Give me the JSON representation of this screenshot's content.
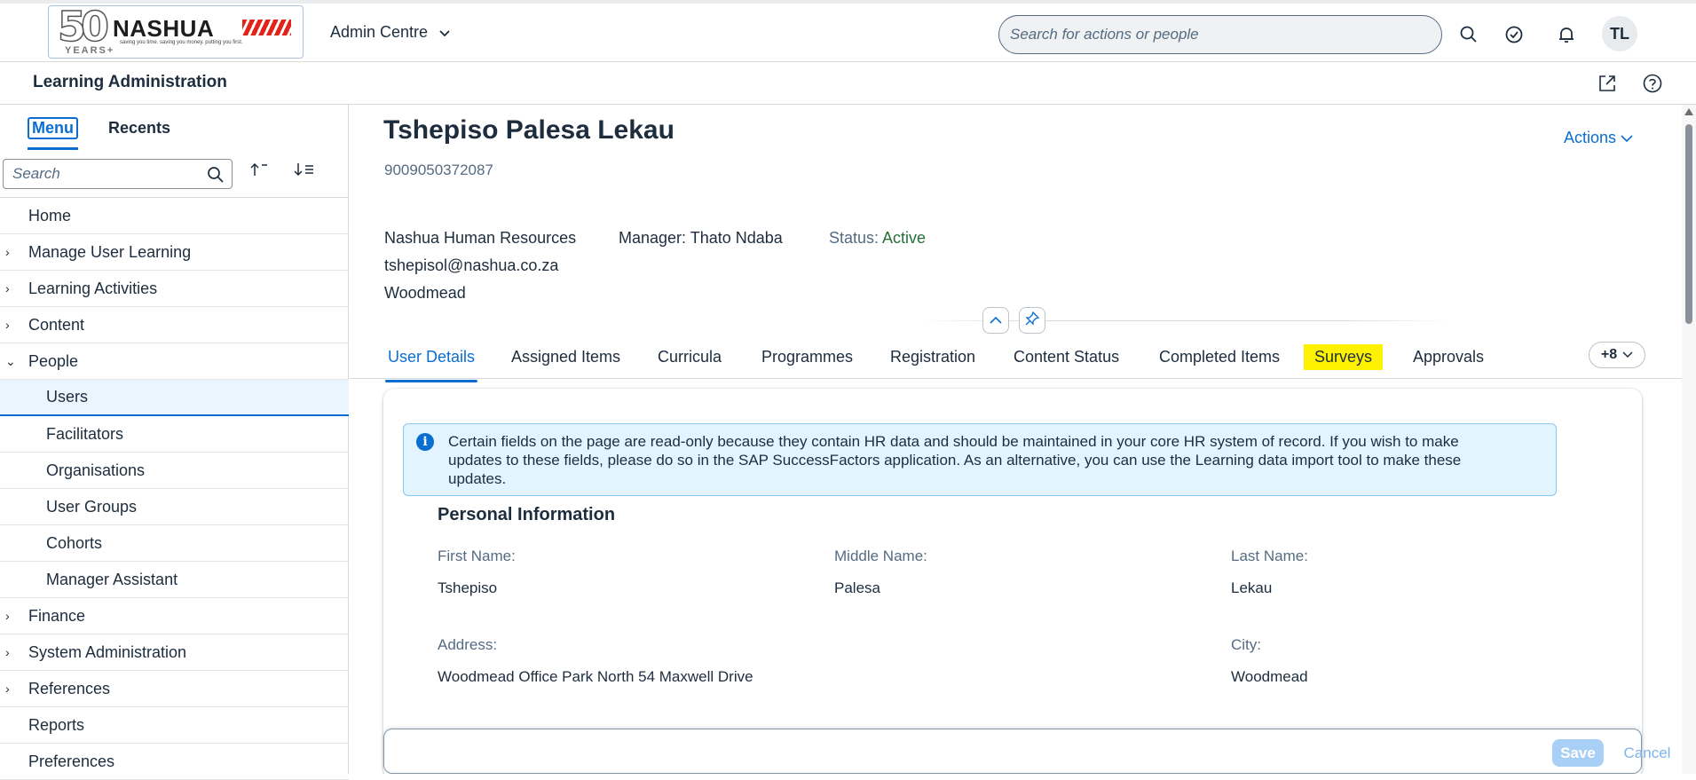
{
  "shell": {
    "logo": {
      "fifty": "50",
      "brand": "NASHUA",
      "tagline": "saving you time. saving you money. putting you first.",
      "years": "YEARS+"
    },
    "app_title": "Admin Centre",
    "search_placeholder": "Search for actions or people",
    "avatar_initials": "TL"
  },
  "subheader": {
    "title": "Learning Administration"
  },
  "nav": {
    "tabs": {
      "menu": "Menu",
      "recents": "Recents"
    },
    "search_placeholder": "Search",
    "items": [
      {
        "label": "Home",
        "expand": ""
      },
      {
        "label": "Manage User Learning",
        "expand": "›"
      },
      {
        "label": "Learning Activities",
        "expand": "›"
      },
      {
        "label": "Content",
        "expand": "›"
      },
      {
        "label": "People",
        "expand": "⌄"
      },
      {
        "label": "Users",
        "expand": ""
      },
      {
        "label": "Facilitators",
        "expand": ""
      },
      {
        "label": "Organisations",
        "expand": ""
      },
      {
        "label": "User Groups",
        "expand": ""
      },
      {
        "label": "Cohorts",
        "expand": ""
      },
      {
        "label": "Manager Assistant",
        "expand": ""
      },
      {
        "label": "Finance",
        "expand": "›"
      },
      {
        "label": "System Administration",
        "expand": "›"
      },
      {
        "label": "References",
        "expand": "›"
      },
      {
        "label": "Reports",
        "expand": ""
      },
      {
        "label": "Preferences",
        "expand": ""
      }
    ]
  },
  "header": {
    "name": "Tshepiso Palesa Lekau",
    "id": "9009050372087",
    "actions": "Actions",
    "department": "Nashua Human Resources",
    "manager": "Manager: Thato Ndaba",
    "status_label": "Status:",
    "status_value": "Active",
    "email": "tshepisol@nashua.co.za",
    "location": "Woodmead"
  },
  "tabs": [
    "User Details",
    "Assigned Items",
    "Curricula",
    "Programmes",
    "Registration",
    "Content Status",
    "Completed Items",
    "Surveys",
    "Approvals"
  ],
  "more_tabs": "+8",
  "message": "Certain fields on the page are read-only because they contain HR data and should be maintained in your core HR system of record. If you wish to make updates to these fields, please do so in the SAP SuccessFactors application. As an alternative, you can use the Learning data import tool to make these updates.",
  "personal": {
    "title": "Personal Information",
    "first_name_label": "First Name:",
    "first_name": "Tshepiso",
    "middle_name_label": "Middle Name:",
    "middle_name": "Palesa",
    "last_name_label": "Last Name:",
    "last_name": "Lekau",
    "address_label": "Address:",
    "address": "Woodmead Office Park North 54 Maxwell Drive",
    "city_label": "City:",
    "city": "Woodmead"
  },
  "footer": {
    "save": "Save",
    "cancel": "Cancel"
  },
  "colors": {
    "accent": "#0a6ed1",
    "status_active": "#256f3a",
    "highlight": "#fff200"
  }
}
